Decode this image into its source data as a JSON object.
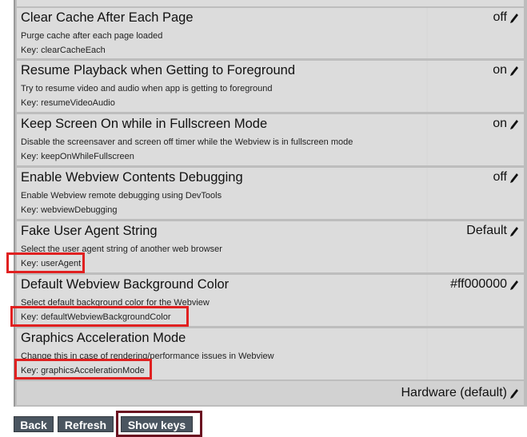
{
  "settings": [
    {
      "title": "Clear Cache After Each Page",
      "description": "Purge cache after each page loaded",
      "key": "Key: clearCacheEach",
      "value": "off"
    },
    {
      "title": "Resume Playback when Getting to Foreground",
      "description": "Try to resume video and audio when app is getting to foreground",
      "key": "Key: resumeVideoAudio",
      "value": "on"
    },
    {
      "title": "Keep Screen On while in Fullscreen Mode",
      "description": "Disable the screensaver and screen off timer while the Webview is in fullscreen mode",
      "key": "Key: keepOnWhileFullscreen",
      "value": "on"
    },
    {
      "title": "Enable Webview Contents Debugging",
      "description": "Enable Webview remote debugging using DevTools",
      "key": "Key: webviewDebugging",
      "value": "off"
    },
    {
      "title": "Fake User Agent String",
      "description": "Select the user agent string of another web browser",
      "key": "Key: userAgent",
      "value": "Default"
    },
    {
      "title": "Default Webview Background Color",
      "description": "Select default background color for the Webview",
      "key": "Key: defaultWebviewBackgroundColor",
      "value": "#ff000000"
    },
    {
      "title": "Graphics Acceleration Mode",
      "description": "Change this in case of rendering/performance issues in Webview",
      "key": "Key: graphicsAccelerationMode",
      "value": ""
    }
  ],
  "footer_value": "Hardware (default)",
  "buttons": {
    "back": "Back",
    "refresh": "Refresh",
    "show_keys": "Show keys"
  },
  "colors": {
    "highlight": "#e02020",
    "button_bg": "#4a5560",
    "button_highlight": "#6b1020"
  },
  "icons": {
    "edit": "pencil-icon"
  }
}
